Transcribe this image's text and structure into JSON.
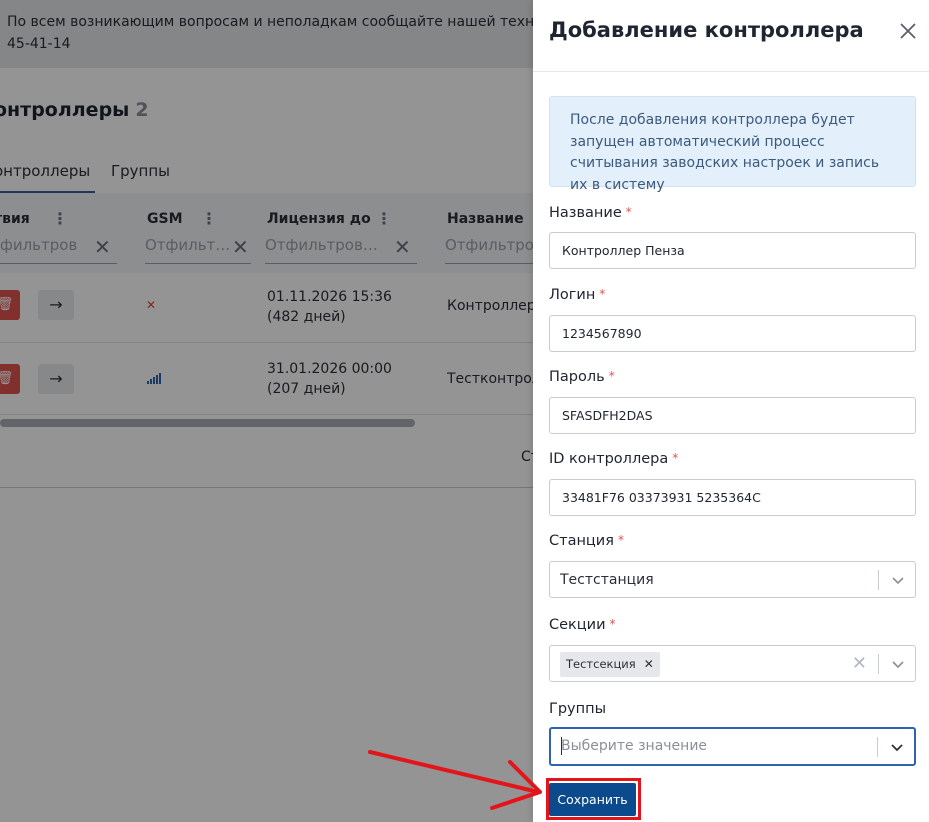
{
  "background": {
    "notice_line1": "По всем возникающим вопросам и неполадкам сообщайте нашей техническо",
    "notice_line2": "45-41-14",
    "page_title": "онтроллеры",
    "page_count": "2",
    "tabs": {
      "controllers": "онтроллеры",
      "groups": "Группы"
    },
    "columns": {
      "actions": "твия",
      "gsm": "GSM",
      "license": "Лицензия до",
      "name": "Название"
    },
    "filters": {
      "actions": "фильтров",
      "gsm": "Отфильт…",
      "license": "Отфильтров…",
      "name": "Отфильтров"
    },
    "rows": [
      {
        "license_date": "01.11.2026 15:36",
        "license_days": "(482 дней)",
        "name": "Контроллер",
        "gsm": "none"
      },
      {
        "license_date": "31.01.2026 00:00",
        "license_days": "(207 дней)",
        "name": "Тестконтрол",
        "gsm": "signal"
      }
    ],
    "pager_text": "Ст"
  },
  "drawer": {
    "title": "Добавление контроллера",
    "info": "После добавления контроллера будет запущен автоматический процесс считывания заводских настроек и запись их в систему",
    "required_mark": "*",
    "fields": {
      "name": {
        "label": "Название",
        "value": "Контроллер Пенза"
      },
      "login": {
        "label": "Логин",
        "value": "1234567890"
      },
      "password": {
        "label": "Пароль",
        "value": "SFASDFH2DAS"
      },
      "controller_id": {
        "label": "ID контроллера",
        "value": "33481F76 03373931 5235364C"
      },
      "station": {
        "label": "Станция",
        "value": "Тестстанция"
      },
      "sections": {
        "label": "Секции",
        "chip": "Тестсекция"
      },
      "groups": {
        "label": "Группы",
        "placeholder": "Выберите значение"
      }
    },
    "save_label": "Сохранить"
  },
  "colors": {
    "accent": "#0b4a8c",
    "delete": "#e1544f",
    "info_bg": "#e3f0fc",
    "highlight": "#e3151b"
  }
}
